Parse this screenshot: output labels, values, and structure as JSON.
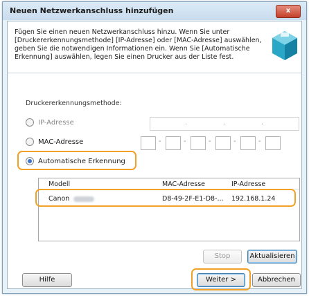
{
  "window": {
    "title": "Neuen Netzwerkanschluss hinzufügen",
    "close_label": "x"
  },
  "description": "Fügen Sie einen neuen Netzwerkanschluss hinzu. Wenn Sie unter [Druckererkennungsmethode] [IP-Adresse] oder [MAC-Adresse] auswählen, geben Sie die notwendigen Informationen ein. Wenn Sie [Automatische Erkennung] auswählen, legen Sie einen Drucker aus der Liste fest.",
  "detection": {
    "label": "Druckererkennungsmethode:",
    "options": [
      {
        "label": "IP-Adresse",
        "selected": false
      },
      {
        "label": "MAC-Adresse",
        "selected": false
      },
      {
        "label": "Automatische Erkennung",
        "selected": true
      }
    ]
  },
  "ip_field": {
    "separators": [
      ".",
      ".",
      "."
    ]
  },
  "mac_field": {
    "separator": "-"
  },
  "printer_list": {
    "columns": [
      "Modell",
      "MAC-Adresse",
      "IP-Adresse"
    ],
    "rows": [
      {
        "model": "Canon",
        "mac": "D8-49-2F-E1-D8-...",
        "ip": "192.168.1.24"
      }
    ]
  },
  "buttons": {
    "stop": "Stop",
    "refresh": "Aktualisieren",
    "help": "Hilfe",
    "next": "Weiter >",
    "cancel": "Abbrechen"
  },
  "colors": {
    "highlight": "#f0a126",
    "accent": "#3a73c8",
    "close_button": "#c3412c"
  }
}
